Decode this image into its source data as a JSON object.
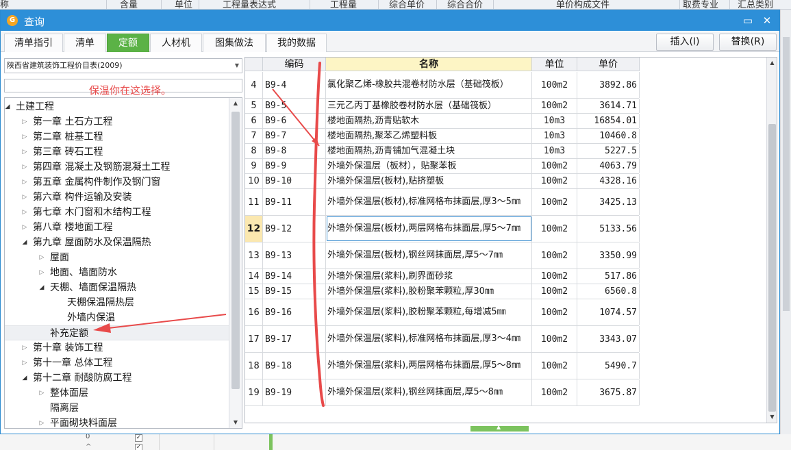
{
  "background_header": {
    "labels": [
      "称",
      "含量",
      "单位",
      "工程量表达式",
      "工程量",
      "综合单价",
      "综合合价",
      "单价构成文件",
      "取费专业",
      "汇总类别"
    ]
  },
  "background_bottom": {
    "row1_value": "0",
    "row2_value": "^"
  },
  "dialog": {
    "title": "查询",
    "logo_glyph": "G",
    "maximize_glyph": "▭",
    "close_glyph": "✕"
  },
  "tabs": [
    {
      "label": "清单指引",
      "active": false
    },
    {
      "label": "清单",
      "active": false
    },
    {
      "label": "定额",
      "active": true
    },
    {
      "label": "人材机",
      "active": false
    },
    {
      "label": "图集做法",
      "active": false
    },
    {
      "label": "我的数据",
      "active": false
    }
  ],
  "actions": {
    "insert_label": "插入(I)",
    "replace_label": "替换(R)"
  },
  "library": {
    "selected": "陕西省建筑装饰工程价目表(2009)",
    "search_value": ""
  },
  "annotation": {
    "text": "保温你在这选择。",
    "color": "#e84a4a"
  },
  "tree": [
    {
      "label": "土建工程",
      "level": 0,
      "state": "expanded"
    },
    {
      "label": "第一章 土石方工程",
      "level": 1,
      "state": "collapsed"
    },
    {
      "label": "第二章 桩基工程",
      "level": 1,
      "state": "collapsed"
    },
    {
      "label": "第三章 砖石工程",
      "level": 1,
      "state": "collapsed"
    },
    {
      "label": "第四章 混凝土及钢筋混凝土工程",
      "level": 1,
      "state": "collapsed"
    },
    {
      "label": "第五章 金属构件制作及钢门窗",
      "level": 1,
      "state": "collapsed"
    },
    {
      "label": "第六章 构件运输及安装",
      "level": 1,
      "state": "collapsed"
    },
    {
      "label": "第七章 木门窗和木结构工程",
      "level": 1,
      "state": "collapsed"
    },
    {
      "label": "第八章 楼地面工程",
      "level": 1,
      "state": "collapsed"
    },
    {
      "label": "第九章 屋面防水及保温隔热",
      "level": 1,
      "state": "expanded"
    },
    {
      "label": "屋面",
      "level": 2,
      "state": "collapsed"
    },
    {
      "label": "地面、墙面防水",
      "level": 2,
      "state": "collapsed"
    },
    {
      "label": "天棚、墙面保温隔热",
      "level": 2,
      "state": "expanded"
    },
    {
      "label": "天棚保温隔热层",
      "level": 3,
      "state": "leaf"
    },
    {
      "label": "外墙内保温",
      "level": 3,
      "state": "leaf"
    },
    {
      "label": "补充定额",
      "level": 2,
      "state": "leaf",
      "selected": true
    },
    {
      "label": "第十章 装饰工程",
      "level": 1,
      "state": "collapsed"
    },
    {
      "label": "第十一章 总体工程",
      "level": 1,
      "state": "collapsed"
    },
    {
      "label": "第十二章 耐酸防腐工程",
      "level": 1,
      "state": "expanded"
    },
    {
      "label": "整体面层",
      "level": 2,
      "state": "collapsed"
    },
    {
      "label": "隔离层",
      "level": 2,
      "state": "leaf"
    },
    {
      "label": "平面砌块料面层",
      "level": 2,
      "state": "collapsed"
    }
  ],
  "grid": {
    "columns": [
      "",
      "编码",
      "名称",
      "单位",
      "单价"
    ],
    "rows": [
      {
        "no": "4",
        "code": "B9-4",
        "name": "氯化聚乙烯-橡胶共混卷材防水层（基础筏板）",
        "unit": "100m2",
        "price": "3892.86",
        "tall": true
      },
      {
        "no": "5",
        "code": "B9-5",
        "name": "三元乙丙丁基橡胶卷材防水层（基础筏板）",
        "unit": "100m2",
        "price": "3614.71"
      },
      {
        "no": "6",
        "code": "B9-6",
        "name": "楼地面隔热,沥青贴软木",
        "unit": "10m3",
        "price": "16854.01"
      },
      {
        "no": "7",
        "code": "B9-7",
        "name": "楼地面隔热,聚苯乙烯塑料板",
        "unit": "10m3",
        "price": "10460.8"
      },
      {
        "no": "8",
        "code": "B9-8",
        "name": "楼地面隔热,沥青铺加气混凝土块",
        "unit": "10m3",
        "price": "5227.5"
      },
      {
        "no": "9",
        "code": "B9-9",
        "name": "外墙外保温层（板材），贴聚苯板",
        "unit": "100m2",
        "price": "4063.79"
      },
      {
        "no": "10",
        "code": "B9-10",
        "name": "外墙外保温层(板材),贴挤塑板",
        "unit": "100m2",
        "price": "4328.16"
      },
      {
        "no": "11",
        "code": "B9-11",
        "name": "外墙外保温层(板材),标准网格布抹面层,厚3～5㎜",
        "unit": "100m2",
        "price": "3425.13",
        "tall": true
      },
      {
        "no": "12",
        "code": "B9-12",
        "name": "外墙外保温层(板材),两层网格布抹面层,厚5～7㎜",
        "unit": "100m2",
        "price": "5133.56",
        "tall": true,
        "selected": true
      },
      {
        "no": "13",
        "code": "B9-13",
        "name": "外墙外保温层(板材),钢丝网抹面层,厚5～7㎜",
        "unit": "100m2",
        "price": "3350.99",
        "tall": true
      },
      {
        "no": "14",
        "code": "B9-14",
        "name": "外墙外保温层(浆料),刷界面砂浆",
        "unit": "100m2",
        "price": "517.86"
      },
      {
        "no": "15",
        "code": "B9-15",
        "name": "外墙外保温层(浆料),胶粉聚苯颗粒,厚30㎜",
        "unit": "100m2",
        "price": "6560.8"
      },
      {
        "no": "16",
        "code": "B9-16",
        "name": "外墙外保温层(浆料),胶粉聚苯颗粒,每增减5㎜",
        "unit": "100m2",
        "price": "1074.57",
        "tall": true
      },
      {
        "no": "17",
        "code": "B9-17",
        "name": "外墙外保温层(浆料),标准网格布抹面层,厚3～4㎜",
        "unit": "100m2",
        "price": "3343.07",
        "tall": true
      },
      {
        "no": "18",
        "code": "B9-18",
        "name": "外墙外保温层(浆料),两层网格布抹面层,厚5～8㎜",
        "unit": "100m2",
        "price": "5490.7",
        "tall": true
      },
      {
        "no": "19",
        "code": "B9-19",
        "name": "外墙外保温层(浆料),钢丝网抹面层,厚5～8㎜",
        "unit": "100m2",
        "price": "3675.87",
        "tall": true
      }
    ]
  },
  "icons": {
    "expanded": "◢",
    "collapsed": "▷",
    "scroll_up": "▲",
    "scroll_down": "▼",
    "dropdown": "▼",
    "check": "✓"
  }
}
